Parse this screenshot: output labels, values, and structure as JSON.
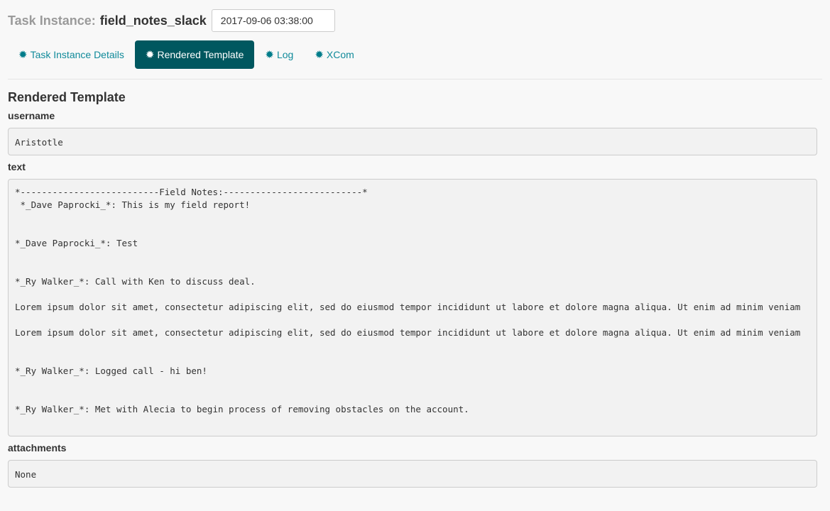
{
  "header": {
    "label": "Task Instance:",
    "task_name": "field_notes_slack",
    "execution_date": "2017-09-06 03:38:00"
  },
  "tabs": [
    {
      "label": "Task Instance Details",
      "icon": "cog-icon"
    },
    {
      "label": "Rendered Template",
      "icon": "cog-icon"
    },
    {
      "label": "Log",
      "icon": "cog-icon"
    },
    {
      "label": "XCom",
      "icon": "cog-icon"
    }
  ],
  "active_tab": "Rendered Template",
  "colors": {
    "accent": "#00575f",
    "link": "#108a9a"
  },
  "rendered": {
    "title": "Rendered Template",
    "fields": {
      "username": {
        "label": "username",
        "value": "Aristotle"
      },
      "text": {
        "label": "text",
        "value": "*--------------------------Field Notes:--------------------------*\n *_Dave Paprocki_*: This is my field report!\n\n\n*_Dave Paprocki_*: Test\n\n\n*_Ry Walker_*: Call with Ken to discuss deal.\n\nLorem ipsum dolor sit amet, consectetur adipiscing elit, sed do eiusmod tempor incididunt ut labore et dolore magna aliqua. Ut enim ad minim veniam\n\nLorem ipsum dolor sit amet, consectetur adipiscing elit, sed do eiusmod tempor incididunt ut labore et dolore magna aliqua. Ut enim ad minim veniam\n\n\n*_Ry Walker_*: Logged call - hi ben!\n\n\n*_Ry Walker_*: Met with Alecia to begin process of removing obstacles on the account."
      },
      "attachments": {
        "label": "attachments",
        "value": "None"
      }
    }
  }
}
